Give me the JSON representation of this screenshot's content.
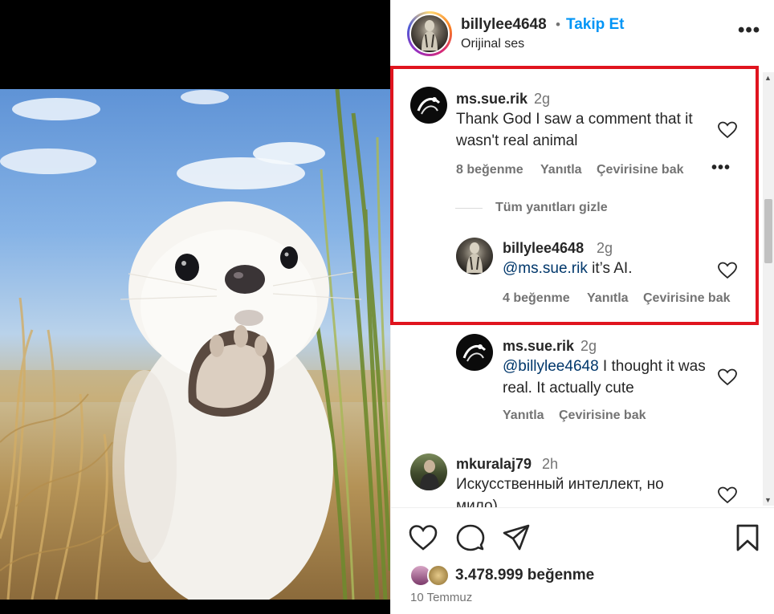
{
  "post": {
    "username": "billylee4648",
    "separator": "•",
    "follow_label": "Takip Et",
    "audio": "Orijinal ses",
    "more": "•••"
  },
  "comments": [
    {
      "username": "ms.sue.rik",
      "time": "2g",
      "text": "Thank God I saw a comment that it wasn't real animal",
      "likes": "8 beğenme",
      "reply": "Yanıtla",
      "translate": "Çevirisine bak",
      "more": "•••",
      "hide_replies": "Tüm yanıtları gizle",
      "replies": [
        {
          "username": "billylee4648",
          "time": "2g",
          "mention": "@ms.sue.rik",
          "text": " it’s AI.",
          "likes": "4 beğenme",
          "reply": "Yanıtla",
          "translate": "Çevirisine bak"
        },
        {
          "username": "ms.sue.rik",
          "time": "2g",
          "mention": "@billylee4648",
          "text": " I thought it was real. It actually cute",
          "reply": "Yanıtla",
          "translate": "Çevirisine bak"
        }
      ]
    },
    {
      "username": "mkuralaj79",
      "time": "2h",
      "text": "Искусственный интеллект, но мило)"
    }
  ],
  "footer": {
    "likes": "3.478.999 beğenme",
    "date": "10 Temmuz"
  },
  "colors": {
    "accent": "#0095f6",
    "highlight_border": "#e0141e",
    "mention": "#00376b",
    "secondary_text": "#737373"
  },
  "icons": [
    "heart-icon",
    "comment-icon",
    "share-icon",
    "bookmark-icon",
    "more-icon"
  ]
}
